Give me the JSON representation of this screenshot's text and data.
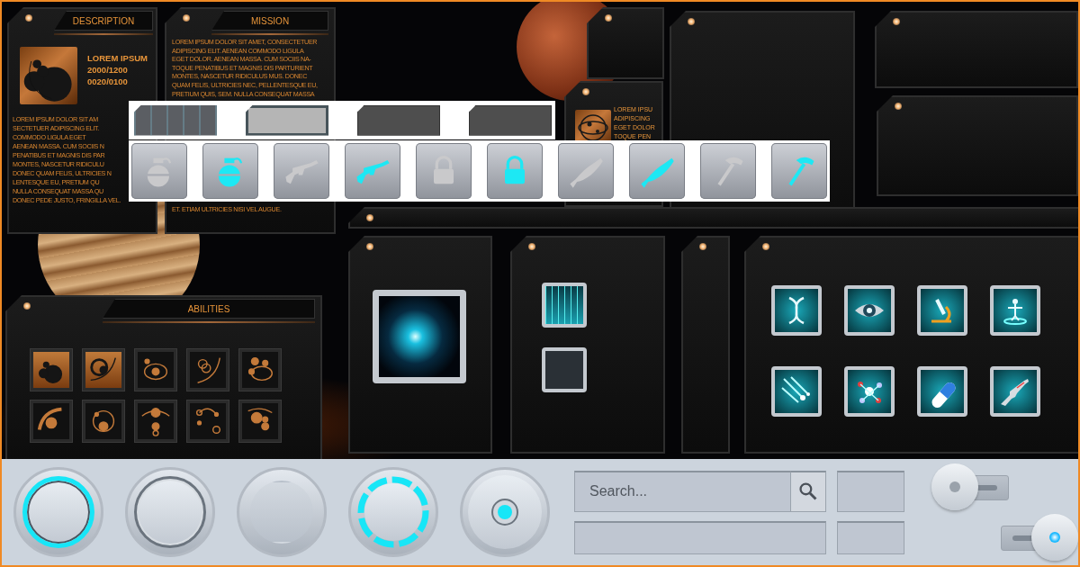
{
  "description": {
    "title": "DESCRIPTION",
    "name": "LOREM IPSUM",
    "stats": [
      "2000/1200",
      "0020/0100"
    ],
    "lines": [
      "LOREM IPSUM DOLOR SIT AM",
      "SECTETUER ADIPISCING ELIT.",
      "COMMODO LIGULA EGET",
      "AENEAN MASSA. CUM SOCIIS N",
      "PENATIBUS ET MAGNIS DIS PAR",
      "MONTES, NASCETUR RIDICULU",
      "DONEC QUAM FELIS, ULTRICIES N",
      "LENTESQUE EU, PRETIUM QU",
      "NULLA CONSEQUAT MASSA QU",
      "DONEC PEDE JUSTO, FRINGILLA VEL."
    ]
  },
  "mission": {
    "title": "MISSION",
    "lines": [
      "LOREM IPSUM DOLOR SIT AMET, CONSECTETUER",
      "ADIPISCING ELIT. AENEAN COMMODO LIGULA",
      "EGET DOLOR. AENEAN MASSA. CUM SOCIIS NA-",
      "TOQUE PENATIBUS ET MAGNIS DIS PARTURIENT",
      "MONTES, NASCETUR RIDICULUS MUS. DONEC",
      "QUAM FELIS, ULTRICIES NEC, PELLENTESQUE EU,",
      "PRETIUM QUIS, SEM. NULLA CONSEQUAT MASSA"
    ],
    "footer": "ET. ETIAM ULTRICIES NISI VEL AUGUE."
  },
  "briefing": {
    "lines": [
      "LOREM IPSU",
      "ADIPISCING",
      "EGET DOLOR",
      "TOQUE PEN"
    ]
  },
  "plates": [
    {
      "kind": "circuit"
    },
    {
      "kind": "light"
    },
    {
      "kind": "dark"
    },
    {
      "kind": "dark"
    }
  ],
  "items": [
    {
      "kind": "grenade",
      "selected": false
    },
    {
      "kind": "grenade",
      "selected": true
    },
    {
      "kind": "rifle",
      "selected": false
    },
    {
      "kind": "rifle",
      "selected": true
    },
    {
      "kind": "lock",
      "selected": false
    },
    {
      "kind": "lock",
      "selected": true
    },
    {
      "kind": "fish",
      "selected": false
    },
    {
      "kind": "fish",
      "selected": true
    },
    {
      "kind": "hammer",
      "selected": false
    },
    {
      "kind": "hammer",
      "selected": true
    }
  ],
  "abilities": {
    "title": "ABILITIES",
    "slots": [
      {
        "filled": true
      },
      {
        "filled": true
      },
      {
        "filled": false
      },
      {
        "filled": false
      },
      {
        "filled": false
      },
      {
        "filled": false
      },
      {
        "filled": false
      },
      {
        "filled": false
      },
      {
        "filled": false
      },
      {
        "filled": false
      }
    ]
  },
  "round_buttons": [
    {
      "kind": "ring",
      "glow": true
    },
    {
      "kind": "ring",
      "glow": false
    },
    {
      "kind": "plain",
      "glow": false
    },
    {
      "kind": "segmented",
      "glow": true
    },
    {
      "kind": "dot",
      "glow": true
    }
  ],
  "search": {
    "placeholder": "Search..."
  },
  "toggles": [
    {
      "on": false
    },
    {
      "on": true
    }
  ]
}
